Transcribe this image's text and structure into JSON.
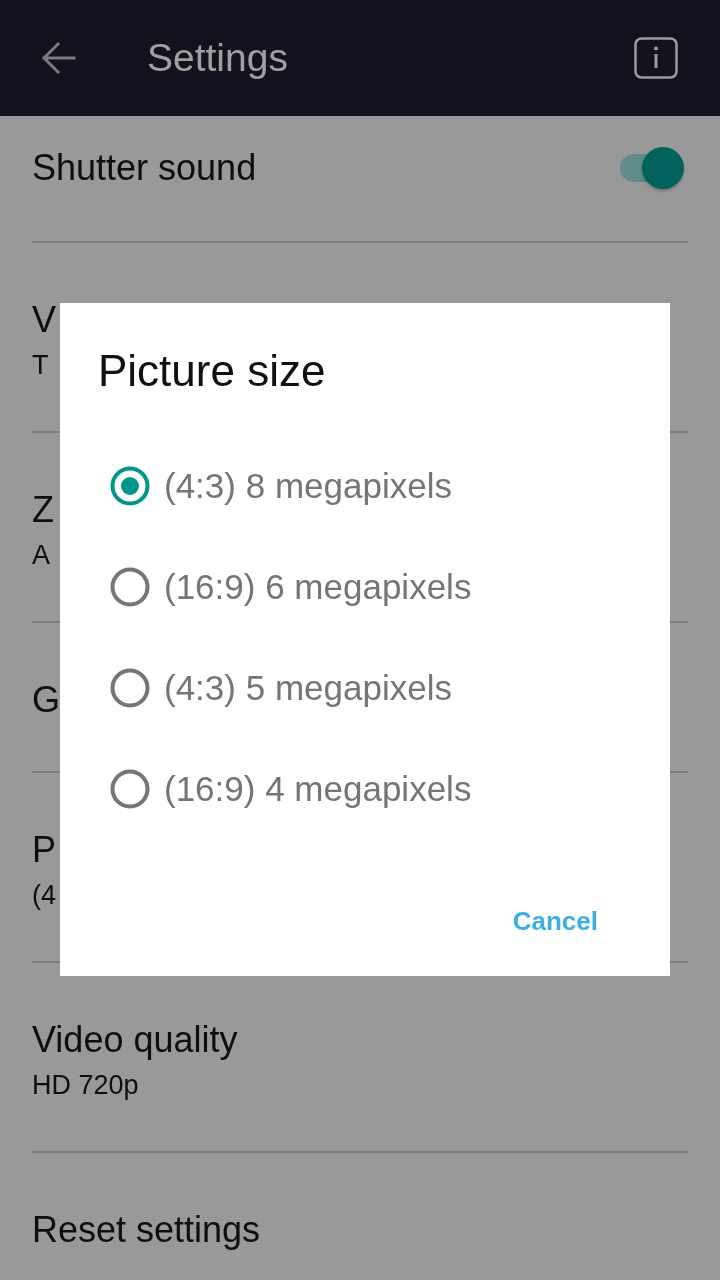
{
  "app_bar": {
    "title": "Settings"
  },
  "settings": [
    {
      "kind": "toggle",
      "title": "Shutter sound",
      "on": true
    },
    {
      "kind": "item",
      "title": "V",
      "subtitle": "T"
    },
    {
      "kind": "item",
      "title": "Z",
      "subtitle": "A"
    },
    {
      "kind": "item",
      "title": "G"
    },
    {
      "kind": "item",
      "title": "P",
      "subtitle": "(4"
    },
    {
      "kind": "item",
      "title": "Video quality",
      "subtitle": "HD 720p"
    },
    {
      "kind": "item",
      "title": "Reset settings"
    }
  ],
  "dialog": {
    "title": "Picture size",
    "options": [
      {
        "label": "(4:3) 8 megapixels",
        "selected": true
      },
      {
        "label": "(16:9) 6 megapixels",
        "selected": false
      },
      {
        "label": "(4:3) 5 megapixels",
        "selected": false
      },
      {
        "label": "(16:9) 4 megapixels",
        "selected": false
      }
    ],
    "buttons": [
      {
        "label": "Cancel"
      }
    ]
  }
}
